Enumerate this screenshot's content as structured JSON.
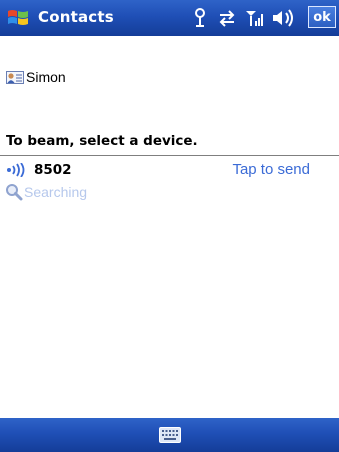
{
  "titlebar": {
    "title": "Contacts",
    "ok_label": "ok",
    "icons": [
      "start-logo-icon",
      "antenna-icon",
      "connectivity-icon",
      "signal-icon",
      "volume-icon"
    ]
  },
  "contact": {
    "name": "Simon",
    "icon": "contact-card-icon"
  },
  "beam": {
    "heading": "To beam, select a device.",
    "devices": [
      {
        "name": "8502",
        "action": "Tap to send",
        "icon": "infrared-icon"
      }
    ],
    "status": "Searching",
    "status_icon": "search-icon"
  },
  "menubar": {
    "icon": "keyboard-icon"
  },
  "colors": {
    "bar": "#1f4fb6",
    "link": "#3b6bd6",
    "searching": "#b6c8ec"
  }
}
